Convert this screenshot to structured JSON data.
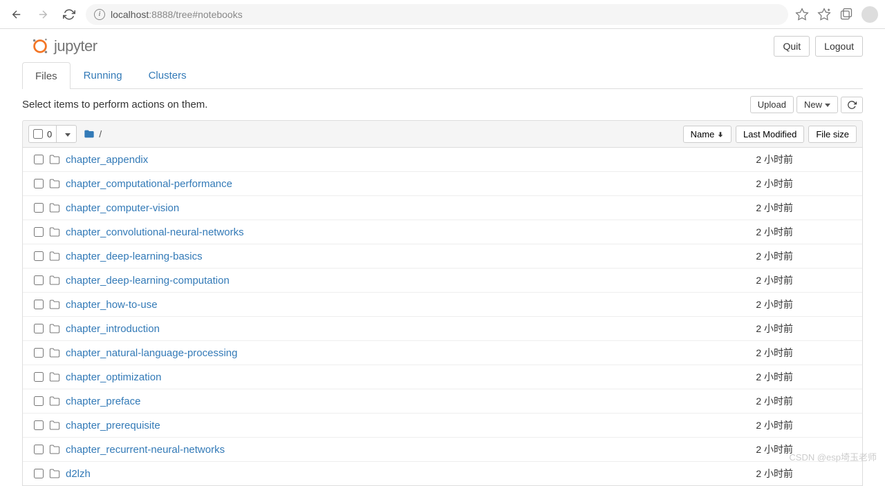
{
  "browser": {
    "url_host": "localhost",
    "url_port": ":8888",
    "url_path": "/tree#notebooks"
  },
  "header": {
    "logo_text": "jupyter",
    "quit_label": "Quit",
    "logout_label": "Logout"
  },
  "tabs": {
    "files": "Files",
    "running": "Running",
    "clusters": "Clusters"
  },
  "toolbar": {
    "hint": "Select items to perform actions on them.",
    "upload_label": "Upload",
    "new_label": "New"
  },
  "list_header": {
    "selected_count": "0",
    "breadcrumb_root": "/",
    "sort_name": "Name",
    "sort_modified": "Last Modified",
    "sort_size": "File size"
  },
  "files": [
    {
      "name": "chapter_appendix",
      "modified": "2 小时前",
      "size": ""
    },
    {
      "name": "chapter_computational-performance",
      "modified": "2 小时前",
      "size": ""
    },
    {
      "name": "chapter_computer-vision",
      "modified": "2 小时前",
      "size": ""
    },
    {
      "name": "chapter_convolutional-neural-networks",
      "modified": "2 小时前",
      "size": ""
    },
    {
      "name": "chapter_deep-learning-basics",
      "modified": "2 小时前",
      "size": ""
    },
    {
      "name": "chapter_deep-learning-computation",
      "modified": "2 小时前",
      "size": ""
    },
    {
      "name": "chapter_how-to-use",
      "modified": "2 小时前",
      "size": ""
    },
    {
      "name": "chapter_introduction",
      "modified": "2 小时前",
      "size": ""
    },
    {
      "name": "chapter_natural-language-processing",
      "modified": "2 小时前",
      "size": ""
    },
    {
      "name": "chapter_optimization",
      "modified": "2 小时前",
      "size": ""
    },
    {
      "name": "chapter_preface",
      "modified": "2 小时前",
      "size": ""
    },
    {
      "name": "chapter_prerequisite",
      "modified": "2 小时前",
      "size": ""
    },
    {
      "name": "chapter_recurrent-neural-networks",
      "modified": "2 小时前",
      "size": ""
    },
    {
      "name": "d2lzh",
      "modified": "2 小时前",
      "size": ""
    }
  ],
  "watermark": "CSDN @esp埼玉老师"
}
